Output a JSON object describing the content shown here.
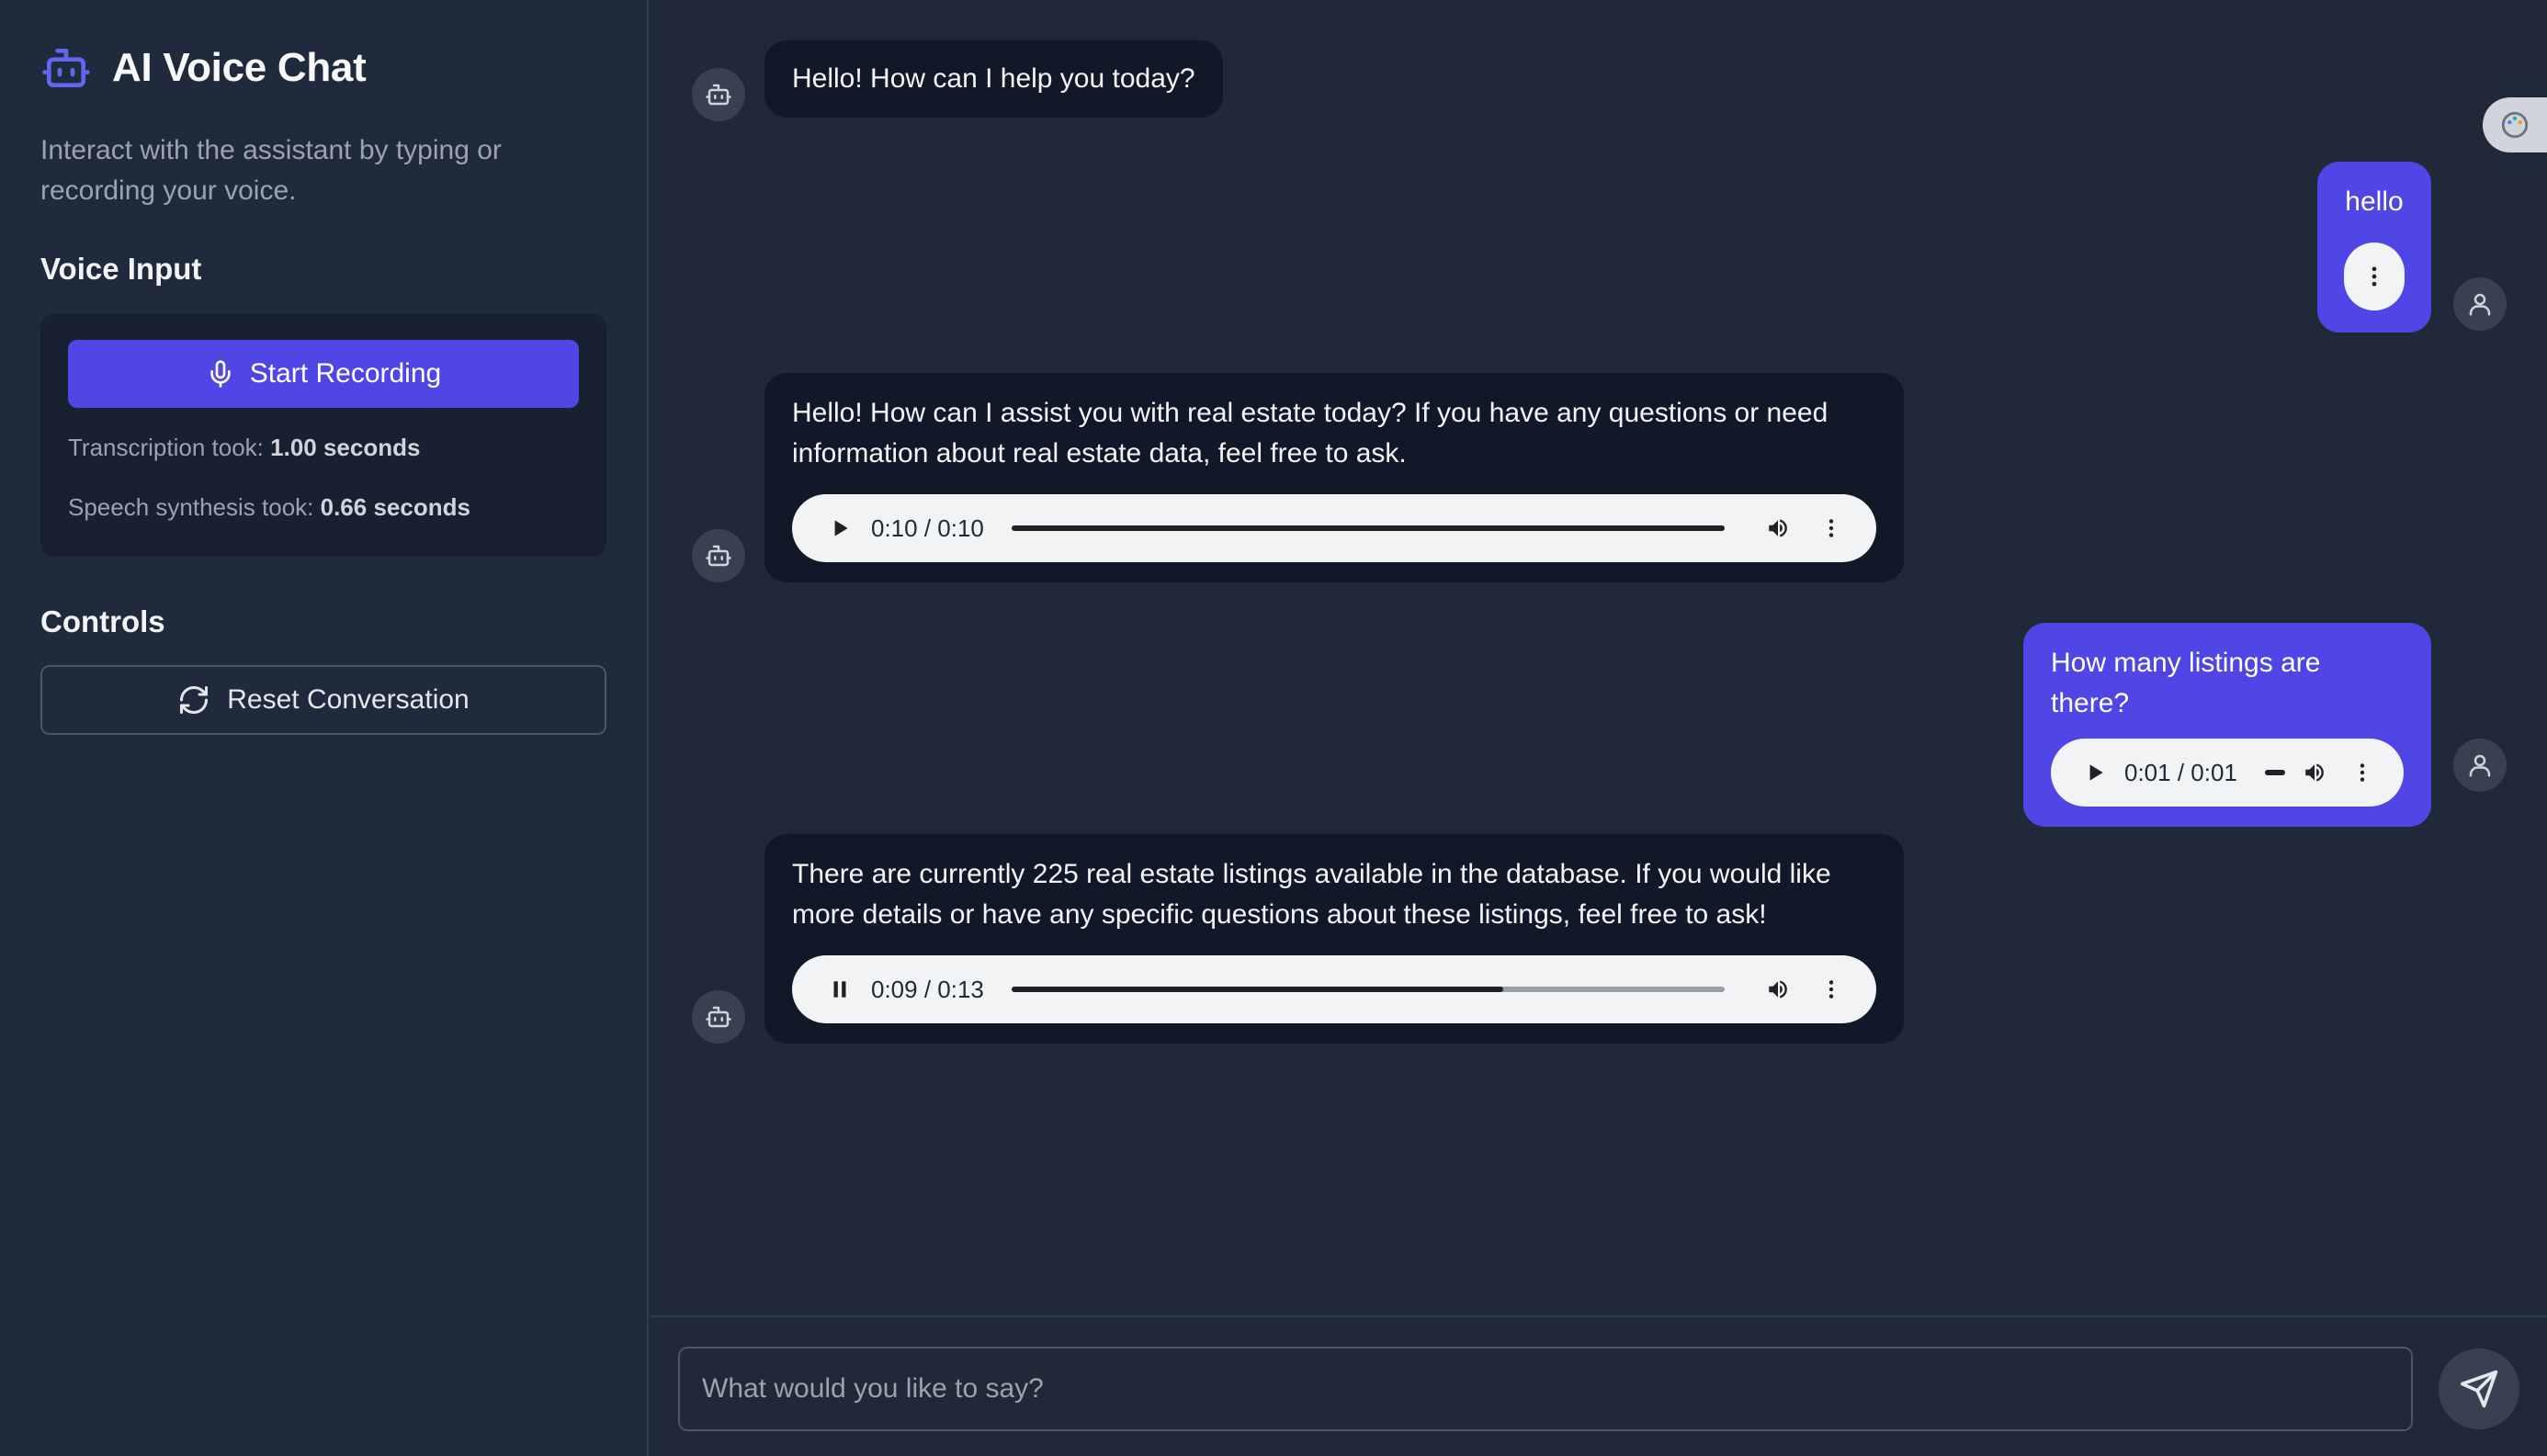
{
  "app": {
    "title": "AI Voice Chat",
    "subtitle": "Interact with the assistant by typing or recording your voice."
  },
  "voice_input": {
    "title": "Voice Input",
    "record_label": "Start Recording",
    "transcription_label": "Transcription took:",
    "transcription_value": "1.00 seconds",
    "synthesis_label": "Speech synthesis took:",
    "synthesis_value": "0.66 seconds"
  },
  "controls": {
    "title": "Controls",
    "reset_label": "Reset Conversation"
  },
  "messages": [
    {
      "role": "assistant",
      "text": "Hello! How can I help you today?"
    },
    {
      "role": "user",
      "text": "hello"
    },
    {
      "role": "assistant",
      "text": "Hello! How can I assist you with real estate today? If you have any questions or need information about real estate data, feel free to ask.",
      "audio": {
        "time": "0:10 / 0:10",
        "state": "paused",
        "progress": 1.0
      }
    },
    {
      "role": "user",
      "text": "How many listings are there?",
      "audio": {
        "time": "0:01 / 0:01",
        "state": "paused",
        "progress": 1.0
      }
    },
    {
      "role": "assistant",
      "text": "There are currently 225 real estate listings available in the database. If you would like more details or have any specific questions about these listings, feel free to ask!",
      "audio": {
        "time": "0:09 / 0:13",
        "state": "playing",
        "progress": 0.69
      }
    }
  ],
  "composer": {
    "placeholder": "What would you like to say?"
  },
  "colors": {
    "accent": "#4f46e5",
    "sidebar_bg": "#1f2a3c",
    "chat_bg": "#1f2937",
    "bot_bubble": "#111827"
  }
}
